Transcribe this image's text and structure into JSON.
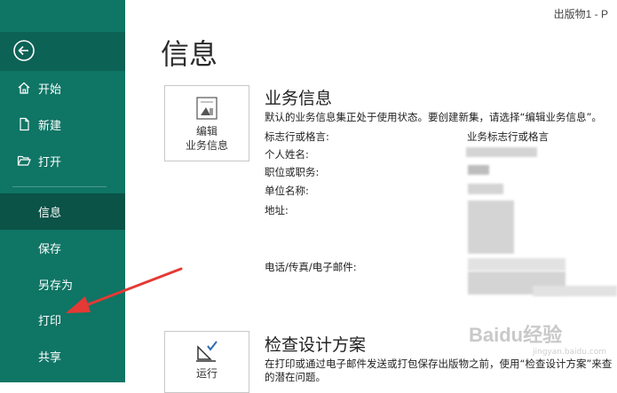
{
  "titlebar": {
    "text": "出版物1 - P"
  },
  "sidebar": {
    "back_icon": "back-arrow-circle-icon",
    "items": [
      {
        "label": "开始",
        "icon": "home-icon"
      },
      {
        "label": "新建",
        "icon": "new-document-icon"
      },
      {
        "label": "打开",
        "icon": "folder-open-icon"
      },
      {
        "label": "信息",
        "active": true
      },
      {
        "label": "保存"
      },
      {
        "label": "另存为"
      },
      {
        "label": "打印"
      },
      {
        "label": "共享"
      }
    ]
  },
  "main": {
    "title": "信息",
    "business_info": {
      "tile_label_line1": "编辑",
      "tile_label_line2": "业务信息",
      "heading": "业务信息",
      "description": "默认的业务信息集正处于使用状态。要创建新集，请选择“编辑业务信息”。",
      "column_header": "业务标志行或格言",
      "fields": [
        "标志行或格言:",
        "个人姓名:",
        "职位或职务:",
        "单位名称:",
        "地址:",
        "电话/传真/电子邮件:"
      ]
    },
    "design_checker": {
      "tile_label": "运行",
      "heading": "检查设计方案",
      "description_line1": "在打印或通过电子邮件发送或打包保存出版物之前，使用“检查设计方案”来查",
      "description_line2": "的潜在问题。"
    }
  },
  "watermark": {
    "text": "Baidu经验",
    "sub": "jingyan.baidu.com"
  },
  "colors": {
    "sidebar": "#0f7565",
    "sidebar_active": "#0b5247",
    "annotation_arrow": "#e53935"
  }
}
